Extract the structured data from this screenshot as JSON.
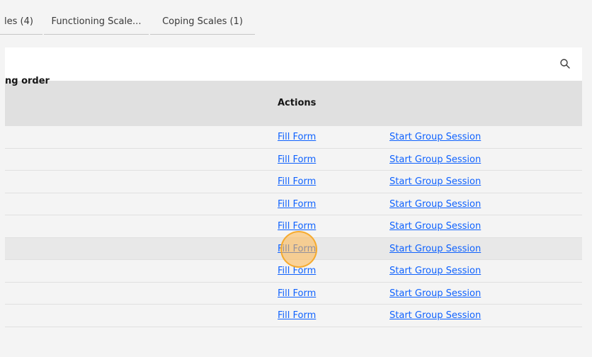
{
  "tabs": [
    {
      "label": "les (4)"
    },
    {
      "label": "Functioning Scale..."
    },
    {
      "label": "Coping Scales (1)"
    }
  ],
  "toolbar": {
    "search_icon": "search-icon"
  },
  "table": {
    "clipped_header": "ng order",
    "actions_header": "Actions",
    "rows": [
      {
        "fill": "Fill Form",
        "group": "Start Group Session"
      },
      {
        "fill": "Fill Form",
        "group": "Start Group Session"
      },
      {
        "fill": "Fill Form",
        "group": "Start Group Session"
      },
      {
        "fill": "Fill Form",
        "group": "Start Group Session"
      },
      {
        "fill": "Fill Form",
        "group": "Start Group Session"
      },
      {
        "fill": "Fill Form",
        "group": "Start Group Session"
      },
      {
        "fill": "Fill Form",
        "group": "Start Group Session"
      },
      {
        "fill": "Fill Form",
        "group": "Start Group Session"
      },
      {
        "fill": "Fill Form",
        "group": "Start Group Session"
      }
    ]
  },
  "colors": {
    "link": "#0f62fe",
    "header_bg": "#e0e0e0",
    "hover_row": "#e8e8e8"
  }
}
